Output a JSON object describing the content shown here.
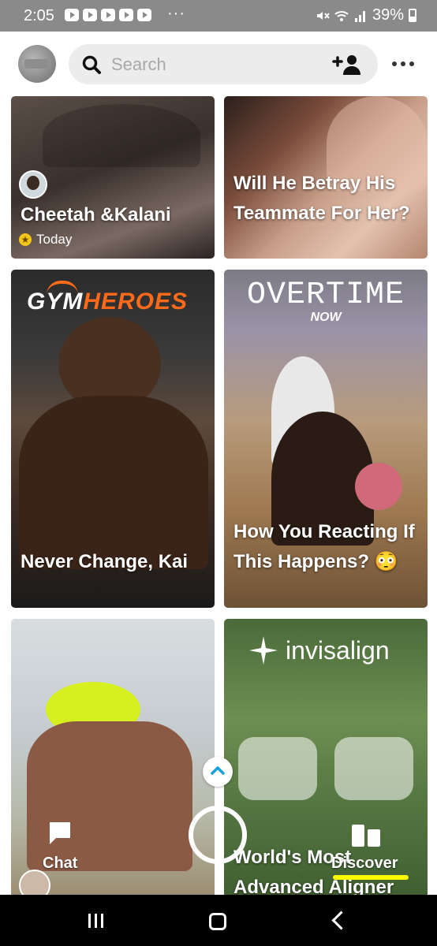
{
  "status_bar": {
    "time": "2:05",
    "more": "···",
    "battery": "39%"
  },
  "header": {
    "search": {
      "placeholder": "Search"
    }
  },
  "tiles": [
    {
      "title": "Cheetah &Kalani",
      "meta": "Today"
    },
    {
      "title": "Will He Betray His Teammate For Her?"
    },
    {
      "logo": {
        "part1": "GYM",
        "part2": "HEROES"
      },
      "title": "Never Change, Kai"
    },
    {
      "logo": {
        "main": "OVERTIME",
        "sub": "NOW"
      },
      "title": "How You Reacting If This Happens? 😳"
    },
    {
      "title": ""
    },
    {
      "logo": {
        "main": "invisalign"
      },
      "title": "World's Most Advanced Aligner"
    }
  ],
  "bottom_nav": {
    "chat_label": "Chat",
    "discover_label": "Discover",
    "accent_color": "#fffc00"
  }
}
